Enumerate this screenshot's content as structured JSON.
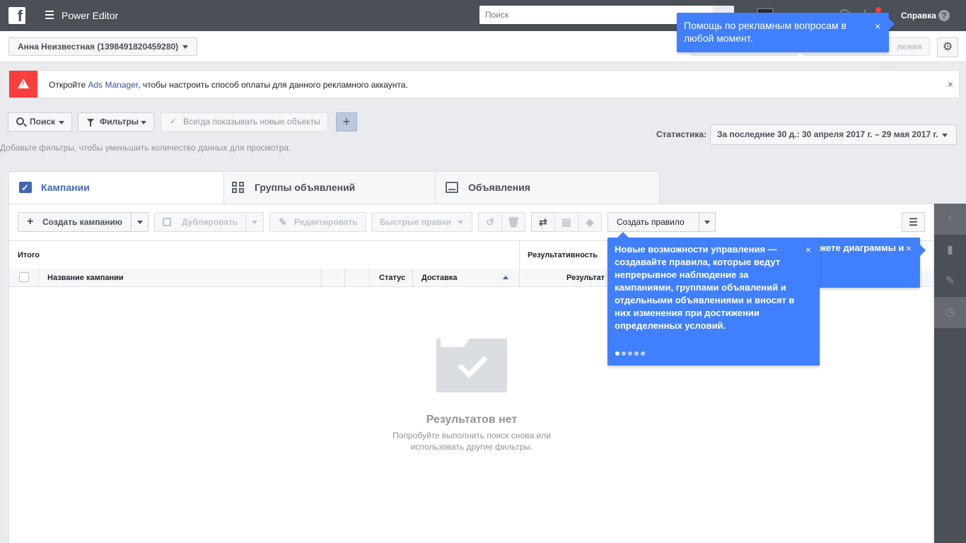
{
  "topbar": {
    "logo": "f",
    "app_title": "Power Editor",
    "search_placeholder": "Поиск",
    "help_label": "Справка",
    "help_icon": "?"
  },
  "accountbar": {
    "account_label": "Анна Неизвестная (1398491820459280)",
    "right_button_partial": "ления"
  },
  "alert": {
    "text_before": "Откройте ",
    "link": "Ads Manager",
    "text_after": ", чтобы настроить способ оплаты для данного рекламного аккаунта."
  },
  "filters": {
    "search_label": "Поиск",
    "filters_label": "Фильтры",
    "always_show_label": "Всегда показывать новые объекты",
    "hint": "Добавьте фильтры, чтобы уменьшить количество данных для просмотра.",
    "stats_label": "Статистика:",
    "date_range": "За последние 30 д.: 30 апреля 2017 г. – 29 мая 2017 г."
  },
  "tabs": [
    {
      "label": "Кампании"
    },
    {
      "label": "Группы объявлений"
    },
    {
      "label": "Объявления"
    }
  ],
  "toolbar": {
    "create_campaign": "Создать кампанию",
    "duplicate": "Дублировать",
    "edit": "Редактировать",
    "quick_edits": "Быстрые правки",
    "create_rule": "Создать правило"
  },
  "table": {
    "total_label": "Итого",
    "performance_label": "Результативность",
    "columns": {
      "name": "Название кампании",
      "status": "Статус",
      "delivery": "Доставка",
      "results_partial": "Результат"
    }
  },
  "empty_state": {
    "title": "Результатов нет",
    "subtitle": "Попробуйте выполнить поиск снова или использовать другие фильтры."
  },
  "tooltips": {
    "help": "Помощь по рекламным вопросам в любой момент.",
    "chart_partial": "жете диаграммы и",
    "rules": "Новые возможности управления — создавайте правила, которые ведут непрерывное наблюдение за кампаниями, группами объявлений и отдельными объявлениями и вносят в них изменения при достижении определенных условий.",
    "close": "×",
    "step_current": 1,
    "step_total": 5
  },
  "colors": {
    "topbar": "#4b4f56",
    "accent_blue": "#4267b2",
    "tooltip_blue": "#4080ff",
    "alert_red": "#fa3e3e"
  },
  "icons": [
    "facebook-logo-icon",
    "menu-icon",
    "search-icon",
    "globe-icon",
    "cart-icon",
    "help-icon",
    "gear-icon",
    "warning-icon",
    "close-icon",
    "filter-icon",
    "check-icon",
    "plus-icon",
    "campaign-check-icon",
    "grid-icon",
    "ad-icon",
    "undo-icon",
    "trash-icon",
    "swap-icon",
    "note-icon",
    "tag-icon",
    "columns-settings-icon",
    "chevron-left-icon",
    "bar-chart-icon",
    "pencil-icon",
    "clock-icon",
    "empty-folder-icon"
  ]
}
